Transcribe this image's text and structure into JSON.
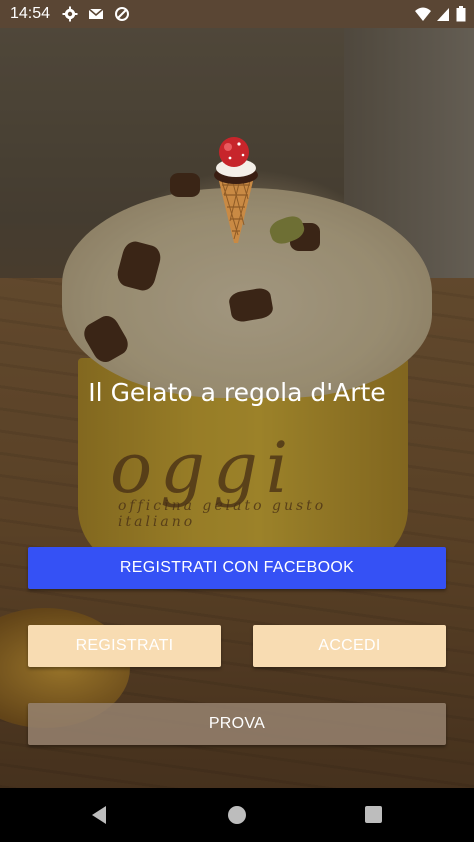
{
  "status_bar": {
    "time": "14:54",
    "left_icons": [
      "gear-icon",
      "gmail-icon",
      "data-saver-icon"
    ],
    "right_icons": [
      "wifi-icon",
      "signal-icon",
      "battery-icon"
    ]
  },
  "main": {
    "tagline": "Il Gelato a regola d'Arte",
    "buttons": {
      "facebook": "REGISTRATI CON FACEBOOK",
      "register": "REGISTRATI",
      "login": "ACCEDI",
      "try": "PROVA"
    },
    "background_cup_text": {
      "brand": "oggi",
      "subtitle": "officina gelato gusto italiano"
    }
  },
  "nav_bar": {
    "icons": [
      "back-icon",
      "home-icon",
      "recents-icon"
    ]
  },
  "colors": {
    "facebook": "#3551f5",
    "peach": "#f8dcb2",
    "status_bar": "#5a4634"
  }
}
